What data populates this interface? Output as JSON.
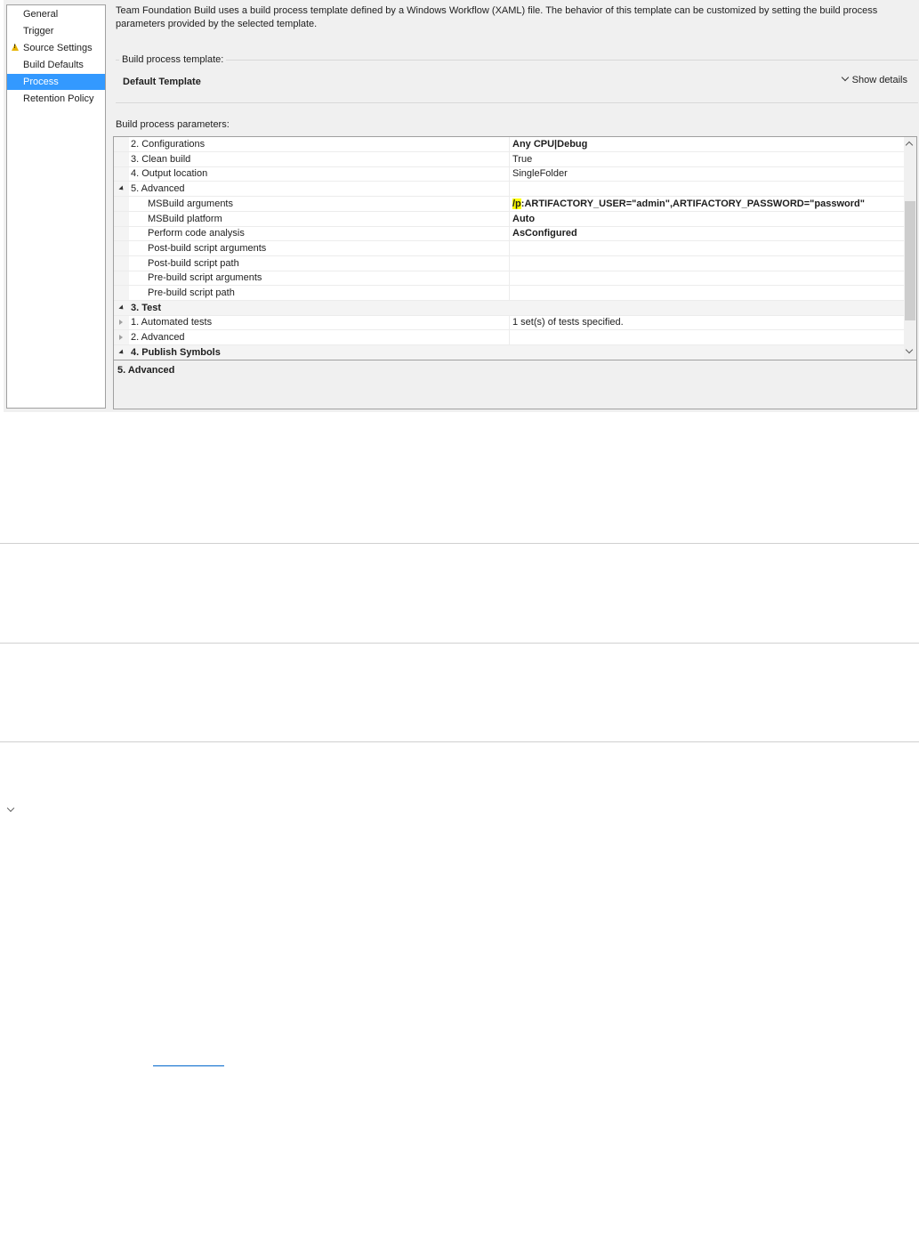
{
  "nav": {
    "items": [
      {
        "label": "General",
        "selected": false,
        "warning": false
      },
      {
        "label": "Trigger",
        "selected": false,
        "warning": false
      },
      {
        "label": "Source Settings",
        "selected": false,
        "warning": true
      },
      {
        "label": "Build Defaults",
        "selected": false,
        "warning": false
      },
      {
        "label": "Process",
        "selected": true,
        "warning": false
      },
      {
        "label": "Retention Policy",
        "selected": false,
        "warning": false
      }
    ]
  },
  "description": "Team Foundation Build uses a build process template defined by a Windows Workflow (XAML) file. The behavior of this template can be customized by setting the build process parameters provided by the selected template.",
  "template": {
    "label": "Build process template:",
    "name": "Default Template",
    "show_details": "Show details"
  },
  "params": {
    "label": "Build process parameters:",
    "rows": [
      {
        "name": "2. Configurations",
        "value_pre": "",
        "value_hl": "",
        "value": "Any CPU|Debug",
        "bold_value": true,
        "level": 1,
        "expander": "",
        "category": false
      },
      {
        "name": "3. Clean build",
        "value_pre": "",
        "value_hl": "",
        "value": "True",
        "bold_value": false,
        "level": 1,
        "expander": "",
        "category": false
      },
      {
        "name": "4. Output location",
        "value_pre": "",
        "value_hl": "",
        "value": "SingleFolder",
        "bold_value": false,
        "level": 1,
        "expander": "",
        "category": false
      },
      {
        "name": "5. Advanced",
        "value_pre": "",
        "value_hl": "",
        "value": "",
        "bold_value": false,
        "level": 1,
        "expander": "open",
        "category": false
      },
      {
        "name": "MSBuild arguments",
        "value_pre": "",
        "value_hl": "/p",
        "value": ":ARTIFACTORY_USER=\"admin\",ARTIFACTORY_PASSWORD=\"password\"",
        "bold_value": true,
        "level": 2,
        "expander": "",
        "category": false
      },
      {
        "name": "MSBuild platform",
        "value_pre": "",
        "value_hl": "",
        "value": "Auto",
        "bold_value": true,
        "level": 2,
        "expander": "",
        "category": false
      },
      {
        "name": "Perform code analysis",
        "value_pre": "",
        "value_hl": "",
        "value": "AsConfigured",
        "bold_value": true,
        "level": 2,
        "expander": "",
        "category": false
      },
      {
        "name": "Post-build script arguments",
        "value_pre": "",
        "value_hl": "",
        "value": "",
        "bold_value": false,
        "level": 2,
        "expander": "",
        "category": false
      },
      {
        "name": "Post-build script path",
        "value_pre": "",
        "value_hl": "",
        "value": "",
        "bold_value": false,
        "level": 2,
        "expander": "",
        "category": false
      },
      {
        "name": "Pre-build script arguments",
        "value_pre": "",
        "value_hl": "",
        "value": "",
        "bold_value": false,
        "level": 2,
        "expander": "",
        "category": false
      },
      {
        "name": "Pre-build script path",
        "value_pre": "",
        "value_hl": "",
        "value": "",
        "bold_value": false,
        "level": 2,
        "expander": "",
        "category": false
      },
      {
        "name": "3. Test",
        "value_pre": "",
        "value_hl": "",
        "value": "",
        "bold_value": false,
        "level": 0,
        "expander": "open",
        "category": true
      },
      {
        "name": "1. Automated tests",
        "value_pre": "",
        "value_hl": "",
        "value": "1 set(s) of tests specified.",
        "bold_value": false,
        "level": 1,
        "expander": "closed",
        "category": false
      },
      {
        "name": "2. Advanced",
        "value_pre": "",
        "value_hl": "",
        "value": "",
        "bold_value": false,
        "level": 1,
        "expander": "closed",
        "category": false
      },
      {
        "name": "4. Publish Symbols",
        "value_pre": "",
        "value_hl": "",
        "value": "",
        "bold_value": false,
        "level": 0,
        "expander": "open",
        "category": true
      }
    ]
  },
  "description_pane": {
    "title": "5. Advanced"
  }
}
